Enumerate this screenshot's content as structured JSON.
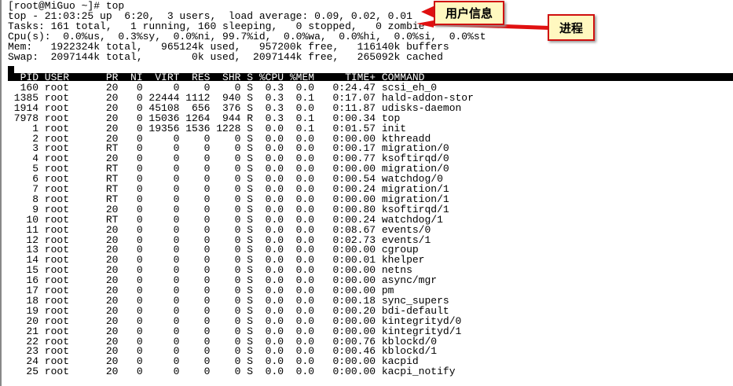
{
  "prompt": "[root@MiGuo ~]# top",
  "summary": [
    "top - 21:03:25 up  6:20,  3 users,  load average: 0.09, 0.02, 0.01",
    "Tasks: 161 total,   1 running, 160 sleeping,   0 stopped,   0 zombie",
    "Cpu(s):  0.0%us,  0.3%sy,  0.0%ni, 99.7%id,  0.0%wa,  0.0%hi,  0.0%si,  0.0%st",
    "Mem:   1922324k total,   965124k used,   957200k free,   116140k buffers",
    "Swap:  2097144k total,        0k used,  2097144k free,   265092k cached"
  ],
  "columns": [
    "PID",
    "USER",
    "PR",
    "NI",
    "VIRT",
    "RES",
    "SHR",
    "S",
    "%CPU",
    "%MEM",
    "TIME+",
    "COMMAND"
  ],
  "processes": [
    [
      "160",
      "root",
      "20",
      "0",
      "0",
      "0",
      "0",
      "S",
      "0.3",
      "0.0",
      "0:24.47",
      "scsi_eh_0"
    ],
    [
      "1385",
      "root",
      "20",
      "0",
      "22444",
      "1112",
      "940",
      "S",
      "0.3",
      "0.1",
      "0:17.07",
      "hald-addon-stor"
    ],
    [
      "1914",
      "root",
      "20",
      "0",
      "45108",
      "656",
      "376",
      "S",
      "0.3",
      "0.0",
      "0:11.87",
      "udisks-daemon"
    ],
    [
      "7978",
      "root",
      "20",
      "0",
      "15036",
      "1264",
      "944",
      "R",
      "0.3",
      "0.1",
      "0:00.34",
      "top"
    ],
    [
      "1",
      "root",
      "20",
      "0",
      "19356",
      "1536",
      "1228",
      "S",
      "0.0",
      "0.1",
      "0:01.57",
      "init"
    ],
    [
      "2",
      "root",
      "20",
      "0",
      "0",
      "0",
      "0",
      "S",
      "0.0",
      "0.0",
      "0:00.00",
      "kthreadd"
    ],
    [
      "3",
      "root",
      "RT",
      "0",
      "0",
      "0",
      "0",
      "S",
      "0.0",
      "0.0",
      "0:00.17",
      "migration/0"
    ],
    [
      "4",
      "root",
      "20",
      "0",
      "0",
      "0",
      "0",
      "S",
      "0.0",
      "0.0",
      "0:00.77",
      "ksoftirqd/0"
    ],
    [
      "5",
      "root",
      "RT",
      "0",
      "0",
      "0",
      "0",
      "S",
      "0.0",
      "0.0",
      "0:00.00",
      "migration/0"
    ],
    [
      "6",
      "root",
      "RT",
      "0",
      "0",
      "0",
      "0",
      "S",
      "0.0",
      "0.0",
      "0:00.54",
      "watchdog/0"
    ],
    [
      "7",
      "root",
      "RT",
      "0",
      "0",
      "0",
      "0",
      "S",
      "0.0",
      "0.0",
      "0:00.24",
      "migration/1"
    ],
    [
      "8",
      "root",
      "RT",
      "0",
      "0",
      "0",
      "0",
      "S",
      "0.0",
      "0.0",
      "0:00.00",
      "migration/1"
    ],
    [
      "9",
      "root",
      "20",
      "0",
      "0",
      "0",
      "0",
      "S",
      "0.0",
      "0.0",
      "0:00.80",
      "ksoftirqd/1"
    ],
    [
      "10",
      "root",
      "RT",
      "0",
      "0",
      "0",
      "0",
      "S",
      "0.0",
      "0.0",
      "0:00.24",
      "watchdog/1"
    ],
    [
      "11",
      "root",
      "20",
      "0",
      "0",
      "0",
      "0",
      "S",
      "0.0",
      "0.0",
      "0:08.67",
      "events/0"
    ],
    [
      "12",
      "root",
      "20",
      "0",
      "0",
      "0",
      "0",
      "S",
      "0.0",
      "0.0",
      "0:02.73",
      "events/1"
    ],
    [
      "13",
      "root",
      "20",
      "0",
      "0",
      "0",
      "0",
      "S",
      "0.0",
      "0.0",
      "0:00.00",
      "cgroup"
    ],
    [
      "14",
      "root",
      "20",
      "0",
      "0",
      "0",
      "0",
      "S",
      "0.0",
      "0.0",
      "0:00.01",
      "khelper"
    ],
    [
      "15",
      "root",
      "20",
      "0",
      "0",
      "0",
      "0",
      "S",
      "0.0",
      "0.0",
      "0:00.00",
      "netns"
    ],
    [
      "16",
      "root",
      "20",
      "0",
      "0",
      "0",
      "0",
      "S",
      "0.0",
      "0.0",
      "0:00.00",
      "async/mgr"
    ],
    [
      "17",
      "root",
      "20",
      "0",
      "0",
      "0",
      "0",
      "S",
      "0.0",
      "0.0",
      "0:00.00",
      "pm"
    ],
    [
      "18",
      "root",
      "20",
      "0",
      "0",
      "0",
      "0",
      "S",
      "0.0",
      "0.0",
      "0:00.18",
      "sync_supers"
    ],
    [
      "19",
      "root",
      "20",
      "0",
      "0",
      "0",
      "0",
      "S",
      "0.0",
      "0.0",
      "0:00.20",
      "bdi-default"
    ],
    [
      "20",
      "root",
      "20",
      "0",
      "0",
      "0",
      "0",
      "S",
      "0.0",
      "0.0",
      "0:00.00",
      "kintegrityd/0"
    ],
    [
      "21",
      "root",
      "20",
      "0",
      "0",
      "0",
      "0",
      "S",
      "0.0",
      "0.0",
      "0:00.00",
      "kintegrityd/1"
    ],
    [
      "22",
      "root",
      "20",
      "0",
      "0",
      "0",
      "0",
      "S",
      "0.0",
      "0.0",
      "0:00.76",
      "kblockd/0"
    ],
    [
      "23",
      "root",
      "20",
      "0",
      "0",
      "0",
      "0",
      "S",
      "0.0",
      "0.0",
      "0:00.46",
      "kblockd/1"
    ],
    [
      "24",
      "root",
      "20",
      "0",
      "0",
      "0",
      "0",
      "S",
      "0.0",
      "0.0",
      "0:00.00",
      "kacpid"
    ],
    [
      "25",
      "root",
      "20",
      "0",
      "0",
      "0",
      "0",
      "S",
      "0.0",
      "0.0",
      "0:00.00",
      "kacpi_notify"
    ]
  ],
  "callouts": {
    "user_info": "用户信息",
    "processes": "进程"
  },
  "colors": {
    "callout_bg": "#fff8c0",
    "callout_border": "#d01010",
    "arrow": "#e01010"
  }
}
